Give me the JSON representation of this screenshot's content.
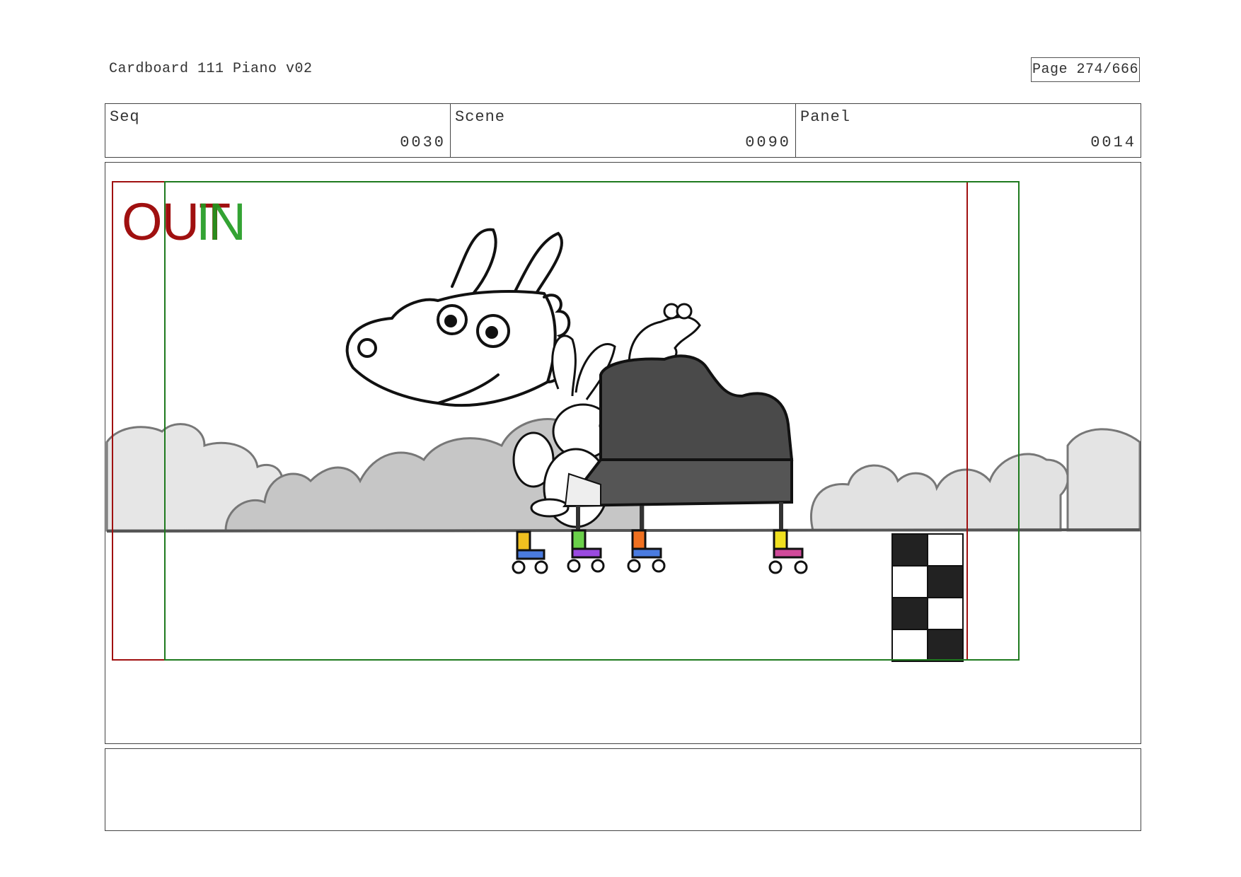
{
  "document": {
    "title": "Cardboard 111 Piano v02",
    "page": "Page 274/666"
  },
  "info": {
    "seq_label": "Seq",
    "seq_value": "0030",
    "scene_label": "Scene",
    "scene_value": "0090",
    "panel_label": "Panel",
    "panel_value": "0014"
  },
  "frame": {
    "out_label": "OUT",
    "in_label": "IN",
    "out_color": "#a01010",
    "in_color": "#1e9a1e"
  },
  "notes": {
    "text": ""
  }
}
